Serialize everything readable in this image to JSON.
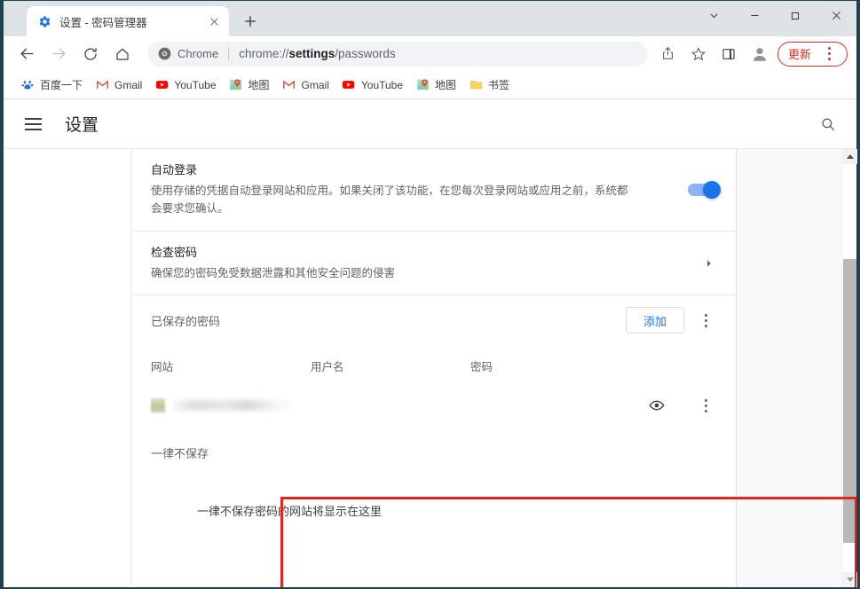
{
  "window": {
    "controls": {
      "tab_search": "chevron-down",
      "minimize": "minimize",
      "maximize": "maximize",
      "close": "close"
    }
  },
  "tabstrip": {
    "tabs": [
      {
        "title": "设置 - 密码管理器",
        "favicon": "gear-icon",
        "close_label": "×"
      }
    ],
    "new_tab_label": "+"
  },
  "toolbar": {
    "back": "back-arrow",
    "forward": "forward-arrow",
    "reload": "reload",
    "home": "home",
    "omnibox": {
      "chip_label": "Chrome",
      "url_prefix": "chrome://",
      "url_bold": "settings",
      "url_suffix": "/passwords",
      "full_url": "chrome://settings/passwords"
    },
    "share": "share-icon",
    "bookmark": "star-icon",
    "side_panel": "side-panel-icon",
    "profile": "avatar",
    "update_label": "更新",
    "menu": "three-dot-menu"
  },
  "bookmarks": [
    {
      "label": "百度一下",
      "icon": "baidu-icon"
    },
    {
      "label": "Gmail",
      "icon": "gmail-icon"
    },
    {
      "label": "YouTube",
      "icon": "youtube-icon"
    },
    {
      "label": "地图",
      "icon": "maps-icon"
    },
    {
      "label": "Gmail",
      "icon": "gmail-icon"
    },
    {
      "label": "YouTube",
      "icon": "youtube-icon"
    },
    {
      "label": "地图",
      "icon": "maps-icon"
    },
    {
      "label": "书签",
      "icon": "folder-icon"
    }
  ],
  "settings_header": {
    "menu_icon": "hamburger-icon",
    "title": "设置",
    "search_icon": "search-icon"
  },
  "content": {
    "auto_signin": {
      "title": "自动登录",
      "description": "使用存储的凭据自动登录网站和应用。如果关闭了该功能，在您每次登录网站或应用之前，系统都会要求您确认。",
      "toggle_on": true
    },
    "check_passwords": {
      "title": "检查密码",
      "description": "确保您的密码免受数据泄露和其他安全问题的侵害",
      "arrow": "chevron-right-icon"
    },
    "saved_passwords": {
      "label": "已保存的密码",
      "add_button": "添加",
      "menu": "three-dot-menu",
      "columns": [
        "网站",
        "用户名",
        "密码"
      ],
      "rows": [
        {
          "site": "",
          "username": "",
          "password": "",
          "redacted": true,
          "show_icon": "eye-icon",
          "menu_icon": "three-dot-menu"
        }
      ]
    },
    "never_saved": {
      "title": "一律不保存",
      "empty_message": "一律不保存密码的网站将显示在这里"
    }
  },
  "highlight": {
    "color": "#e8241c",
    "target": "saved-passwords-table"
  },
  "scrollbar": {
    "up_arrow": "triangle-up",
    "down_arrow": "triangle-down"
  }
}
